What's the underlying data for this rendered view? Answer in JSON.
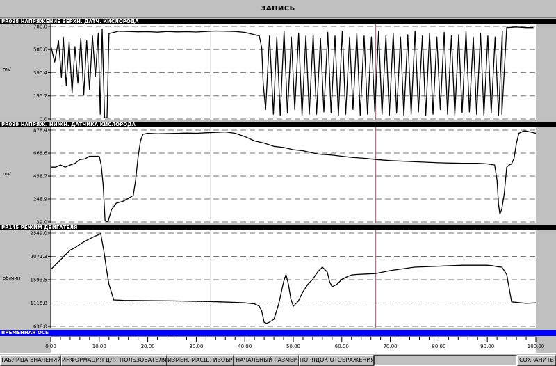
{
  "window": {
    "title": "ЗАПИСЬ"
  },
  "time_axis_label": "ВРЕМЕННАЯ ОСЬ",
  "toolbar": {
    "values_table": "ТАБЛИЦА ЗНАЧЕНИЙ",
    "user_info": "ИНФОРМАЦИЯ ДЛЯ ПОЛЬЗОВАТЕЛЯ",
    "change_scale": "ИЗМЕН. МАСШ. ИЗОБР.",
    "initial_size": "НАЧАЛЬНЫЙ РАЗМЕР",
    "display_order": "ПОРЯДОК ОТОБРАЖЕНИЯ",
    "save": "СОХРАНИТЬ"
  },
  "chart_data": [
    {
      "type": "line",
      "title": "PR098 НАПРЯЖЕНИЕ ВЕРХН. ДАТЧ. КИСЛОРОДА",
      "ylabel": "mV",
      "xlim": [
        0,
        100
      ],
      "ylim": [
        0.0,
        780.0
      ],
      "yticks": [
        "0.0",
        "195.2",
        "390.4",
        "585.6",
        "780.0"
      ],
      "grid": "dashed horizontal",
      "markers": [
        33,
        67
      ],
      "x": [
        0,
        0.8,
        1.6,
        2.2,
        2.6,
        3.2,
        3.8,
        4.4,
        5,
        5.6,
        6.2,
        6.8,
        7.4,
        8,
        8.6,
        9.2,
        9.8,
        10.2,
        10.6,
        11.1,
        11.6,
        12,
        14,
        16,
        18,
        20,
        22,
        24,
        26,
        28,
        30,
        32,
        33,
        34,
        36,
        38,
        40,
        42,
        43,
        43.5,
        43.8,
        44.3,
        45.1,
        45.9,
        46.6,
        47.3,
        48.1,
        48.8,
        49.6,
        50.3,
        51.1,
        51.8,
        52.6,
        53.3,
        54.1,
        54.8,
        55.6,
        56.3,
        57.1,
        57.8,
        58.6,
        59.3,
        60.1,
        60.8,
        61.6,
        62.3,
        63.1,
        63.8,
        64.6,
        65.3,
        66.1,
        66.8,
        67.6,
        68.3,
        69.1,
        69.8,
        70.6,
        71.3,
        72.1,
        72.8,
        73.6,
        74.3,
        75.1,
        75.8,
        76.6,
        77.3,
        78.1,
        78.8,
        79.6,
        80.3,
        81.1,
        81.8,
        82.6,
        83.3,
        84.1,
        84.8,
        85.6,
        86.3,
        87.1,
        87.8,
        88.6,
        89.3,
        90.1,
        90.8,
        91.6,
        92.3,
        93.1,
        93,
        94,
        96,
        98,
        99.5
      ],
      "y": [
        620,
        480,
        660,
        350,
        690,
        280,
        650,
        220,
        610,
        300,
        680,
        200,
        660,
        250,
        700,
        360,
        720,
        40,
        760,
        10,
        10,
        720,
        740,
        738,
        735,
        736,
        732,
        738,
        734,
        736,
        733,
        738,
        740,
        742,
        740,
        738,
        730,
        710,
        700,
        600,
        300,
        80,
        700,
        40,
        690,
        30,
        740,
        50,
        690,
        80,
        720,
        30,
        700,
        40,
        710,
        40,
        680,
        60,
        730,
        50,
        700,
        30,
        740,
        40,
        690,
        80,
        720,
        30,
        700,
        40,
        690,
        60,
        740,
        40,
        700,
        30,
        720,
        50,
        690,
        30,
        710,
        40,
        740,
        60,
        700,
        30,
        720,
        40,
        690,
        80,
        730,
        40,
        700,
        30,
        710,
        50,
        740,
        60,
        690,
        40,
        720,
        30,
        700,
        50,
        690,
        30,
        740,
        40,
        770,
        775,
        770,
        770,
        740
      ]
    },
    {
      "type": "line",
      "title": "PR099 НАПРЯЖ. НИЖН. ДАТЧИКА КИСЛОРОДА",
      "ylabel": "mV",
      "xlim": [
        0,
        100
      ],
      "ylim": [
        39.0,
        878.4
      ],
      "yticks": [
        "39.0",
        "248.9",
        "458.7",
        "668.6",
        "878.4"
      ],
      "grid": "dashed horizontal",
      "markers": [
        33,
        67
      ],
      "x": [
        0,
        1,
        2,
        3,
        4,
        5,
        6,
        7,
        8,
        9,
        10,
        10.4,
        10.8,
        11.2,
        11.8,
        12.5,
        13.5,
        15,
        17,
        17.5,
        18,
        18.5,
        19,
        20,
        22,
        25,
        28,
        30,
        32,
        34,
        36,
        38,
        40,
        42,
        44,
        46,
        48,
        50,
        52,
        55,
        58,
        60,
        62,
        65,
        67,
        70,
        75,
        80,
        85,
        88,
        90,
        91.5,
        92,
        92.3,
        92.6,
        93,
        93.5,
        94,
        94.5,
        95,
        95.5,
        96,
        96.5,
        97,
        97.5,
        98,
        99,
        100
      ],
      "y": [
        540,
        540,
        560,
        540,
        560,
        575,
        610,
        615,
        640,
        640,
        640,
        560,
        380,
        50,
        40,
        150,
        210,
        230,
        280,
        420,
        630,
        780,
        840,
        850,
        845,
        848,
        852,
        850,
        854,
        858,
        862,
        850,
        820,
        780,
        760,
        730,
        720,
        700,
        690,
        660,
        650,
        640,
        630,
        620,
        610,
        600,
        590,
        580,
        575,
        575,
        570,
        560,
        420,
        200,
        110,
        160,
        300,
        540,
        560,
        570,
        620,
        760,
        850,
        860,
        870,
        870,
        860,
        850
      ]
    },
    {
      "type": "line",
      "title": "PR145 РЕЖИМ ДВИГАТЕЛЯ",
      "ylabel": "об/мин",
      "xlim": [
        0,
        100
      ],
      "ylim": [
        638.0,
        2549.0
      ],
      "yticks": [
        "638.0",
        "1115.8",
        "1593.5",
        "2071.3",
        "2549.0"
      ],
      "grid": "dashed horizontal",
      "markers": [
        33,
        67
      ],
      "x": [
        0,
        1,
        2,
        3,
        4,
        5,
        6,
        7,
        8,
        9,
        10,
        10.3,
        11,
        11.5,
        12,
        13,
        15,
        20,
        25,
        30,
        33,
        35,
        38,
        40,
        42,
        43,
        43.5,
        44,
        44.5,
        45,
        46,
        47,
        48,
        48.5,
        49,
        49.5,
        50,
        51,
        52,
        53,
        54,
        55,
        56,
        57,
        57.5,
        58,
        59,
        60,
        61,
        62,
        63,
        65,
        67,
        70,
        75,
        80,
        85,
        90,
        91,
        92,
        93,
        94,
        95,
        98,
        100
      ],
      "y": [
        1800,
        1900,
        2000,
        2100,
        2200,
        2250,
        2320,
        2380,
        2430,
        2480,
        2520,
        2540,
        2150,
        1800,
        1500,
        1180,
        1170,
        1165,
        1160,
        1150,
        1145,
        1140,
        1130,
        1120,
        1100,
        1050,
        950,
        720,
        700,
        720,
        780,
        1100,
        1550,
        1700,
        1500,
        1200,
        1050,
        1150,
        1350,
        1500,
        1600,
        1750,
        1850,
        1750,
        1550,
        1450,
        1500,
        1600,
        1650,
        1690,
        1700,
        1710,
        1720,
        1780,
        1850,
        1870,
        1890,
        1890,
        1880,
        1860,
        1850,
        1700,
        1140,
        1110,
        1120
      ]
    }
  ],
  "time_axis": {
    "xlim": [
      0,
      100
    ],
    "ticks": [
      "0.00",
      "10.00",
      "20.00",
      "30.00",
      "40.00",
      "50.00",
      "60.00",
      "70.00",
      "80.00",
      "90.00",
      "100.00"
    ]
  }
}
